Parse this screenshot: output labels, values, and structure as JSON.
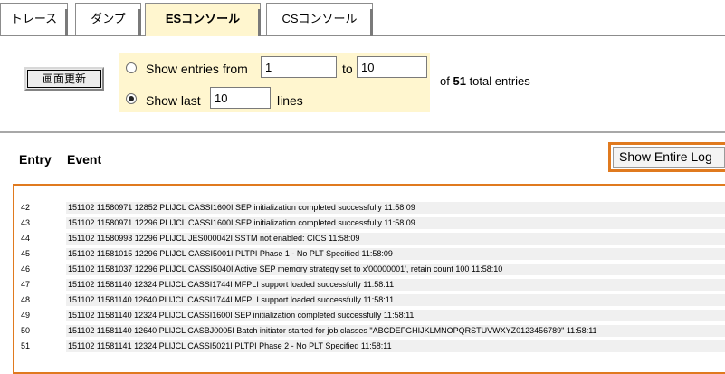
{
  "tabs": [
    {
      "label": "トレース",
      "active": false
    },
    {
      "label": "ダンプ",
      "active": false
    },
    {
      "label": "ESコンソール",
      "active": true
    },
    {
      "label": "CSコンソール",
      "active": false
    }
  ],
  "controls": {
    "refresh_label": "画面更新",
    "range": {
      "from_prefix": "Show entries from",
      "from_value": "1",
      "to_word": "to",
      "to_value": "10",
      "last_prefix": "Show last",
      "last_value": "10",
      "last_suffix": "lines",
      "selected": "last"
    },
    "total_prefix": "of",
    "total_count": "51",
    "total_suffix": "total entries"
  },
  "table": {
    "col_entry": "Entry",
    "col_event": "Event",
    "show_log_label": "Show Entire Log",
    "rows": [
      {
        "entry": "42",
        "event": "151102 11580971 12852 PLIJCL CASSI1600I SEP initialization completed successfully 11:58:09"
      },
      {
        "entry": "43",
        "event": "151102 11580971 12296 PLIJCL CASSI1600I SEP initialization completed successfully 11:58:09"
      },
      {
        "entry": "44",
        "event": "151102 11580993 12296 PLIJCL JES000042I SSTM not enabled: CICS 11:58:09"
      },
      {
        "entry": "45",
        "event": "151102 11581015 12296 PLIJCL CASSI5001I PLTPI Phase 1 - No PLT Specified 11:58:09"
      },
      {
        "entry": "46",
        "event": "151102 11581037 12296 PLIJCL CASSI5040I Active SEP memory strategy set to x'00000001', retain count 100 11:58:10"
      },
      {
        "entry": "47",
        "event": "151102 11581140 12324 PLIJCL CASSI1744I MFPLI support loaded successfully 11:58:11"
      },
      {
        "entry": "48",
        "event": "151102 11581140 12640 PLIJCL CASSI1744I MFPLI support loaded successfully 11:58:11"
      },
      {
        "entry": "49",
        "event": "151102 11581140 12324 PLIJCL CASSI1600I SEP initialization completed successfully 11:58:11"
      },
      {
        "entry": "50",
        "event": "151102 11581140 12640 PLIJCL CASBJ0005I Batch initiator started for job classes \"ABCDEFGHIJKLMNOPQRSTUVWXYZ0123456789\" 11:58:11"
      },
      {
        "entry": "51",
        "event": "151102 11581141 12324 PLIJCL CASSI5021I PLTPI Phase 2 - No PLT Specified 11:58:11"
      }
    ]
  },
  "colors": {
    "active_tab_bg": "#fff6cf",
    "highlight_border": "#e07a1f",
    "row_bg": "#f0f0f0"
  }
}
